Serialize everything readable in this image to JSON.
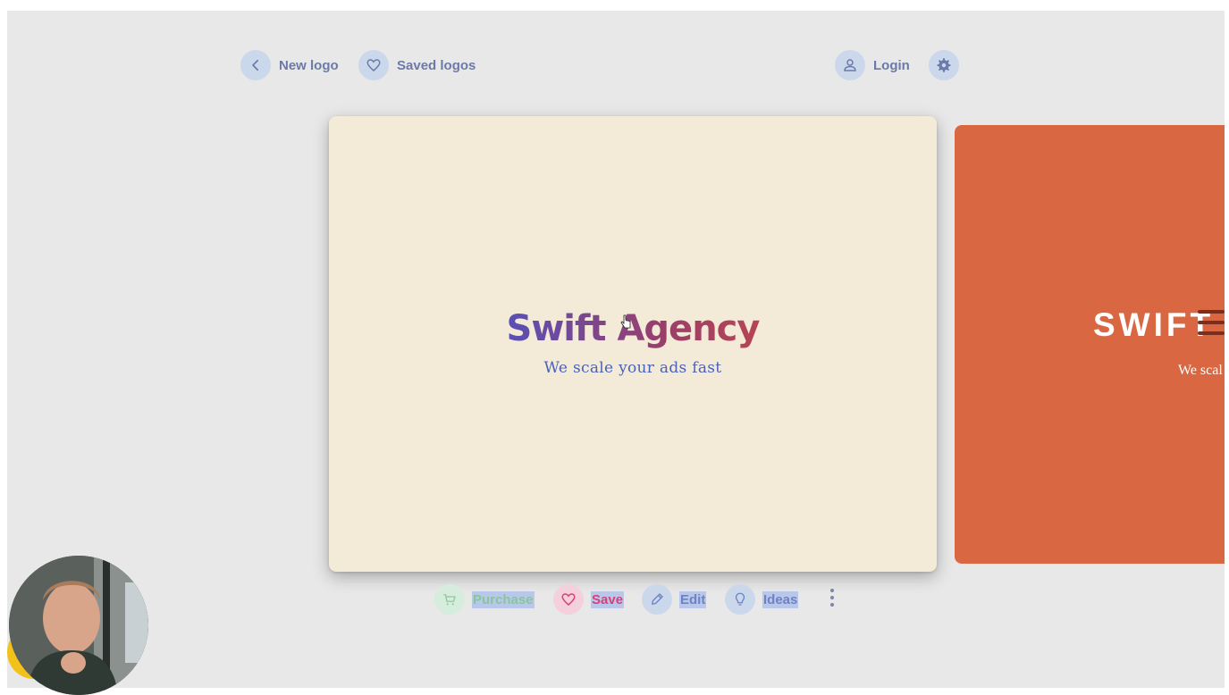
{
  "nav": {
    "new_logo": "New logo",
    "saved_logos": "Saved logos",
    "login": "Login"
  },
  "main_logo": {
    "title": "Swift Agency",
    "tagline": "We scale your ads fast"
  },
  "side_logo": {
    "title": "SWIFT",
    "tagline": "We scal"
  },
  "toolbar": {
    "purchase": "Purchase",
    "save": "Save",
    "edit": "Edit",
    "ideas": "Ideas"
  },
  "colors": {
    "background": "#e8e8e8",
    "card": "#f3ead8",
    "side_card": "#d96842",
    "nav_text": "#6b7aa8",
    "save_accent": "#d8407a"
  },
  "icons": [
    "chevron-left-icon",
    "heart-icon",
    "user-icon",
    "gear-icon",
    "cart-icon",
    "pencil-icon",
    "lightbulb-icon",
    "more-vertical-icon"
  ]
}
